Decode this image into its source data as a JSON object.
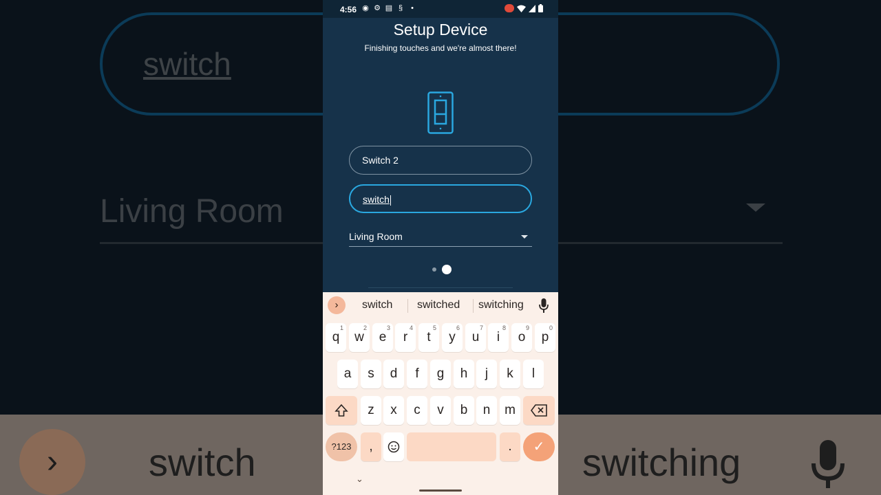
{
  "status_bar": {
    "time": "4:56"
  },
  "screen": {
    "title": "Setup Device",
    "subtitle": "Finishing touches and we're almost there!",
    "name_field": {
      "value": "Switch 2"
    },
    "type_field": {
      "value": "switch"
    },
    "room_select": {
      "value": "Living Room"
    },
    "pager": {
      "total": 2,
      "current": 2
    }
  },
  "keyboard": {
    "suggestions": [
      "switch",
      "switched",
      "switching"
    ],
    "row1": [
      "q",
      "w",
      "e",
      "r",
      "t",
      "y",
      "u",
      "i",
      "o",
      "p"
    ],
    "row1_hints": [
      "1",
      "2",
      "3",
      "4",
      "5",
      "6",
      "7",
      "8",
      "9",
      "0"
    ],
    "row2": [
      "a",
      "s",
      "d",
      "f",
      "g",
      "h",
      "j",
      "k",
      "l"
    ],
    "row3": [
      "z",
      "x",
      "c",
      "v",
      "b",
      "n",
      "m"
    ],
    "symbols_key": "?123",
    "comma_key": ",",
    "period_key": "."
  },
  "colors": {
    "app_bg": "#16324a",
    "accent": "#2aa8e0",
    "keyboard_accent": "#f4a278"
  }
}
